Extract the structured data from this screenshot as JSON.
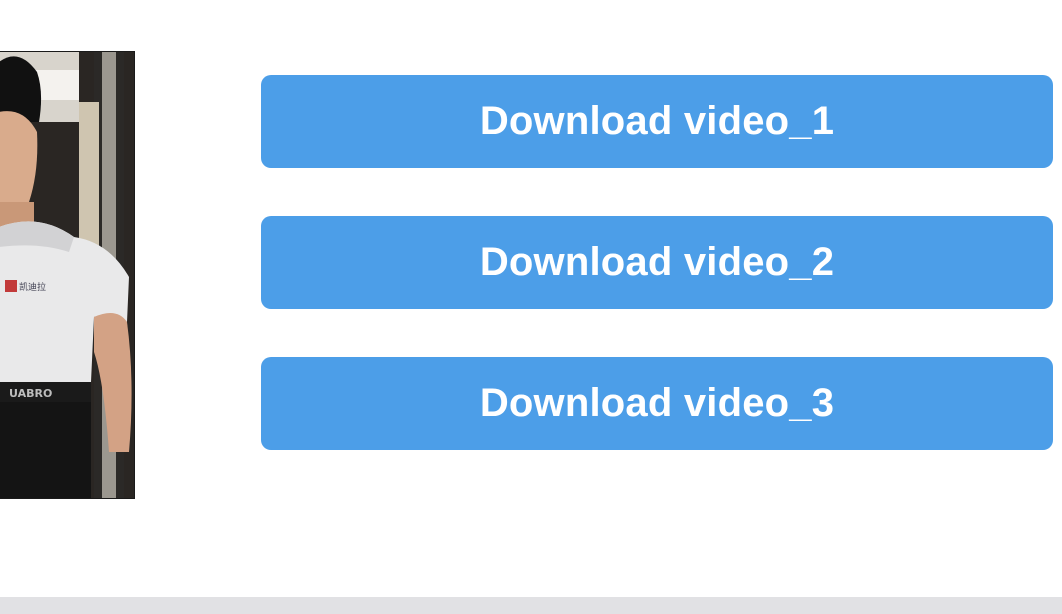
{
  "thumbnail": {
    "icon": "video-thumbnail",
    "shirt_logo_text": "凯迪拉",
    "waistband_text": "UABRO"
  },
  "buttons": [
    {
      "label": "Download video_1"
    },
    {
      "label": "Download video_2"
    },
    {
      "label": "Download video_3"
    }
  ],
  "colors": {
    "button_bg": "#4c9ee8",
    "button_text": "#ffffff",
    "background": "#ffffff",
    "bottom_bar": "#e1e1e4"
  }
}
